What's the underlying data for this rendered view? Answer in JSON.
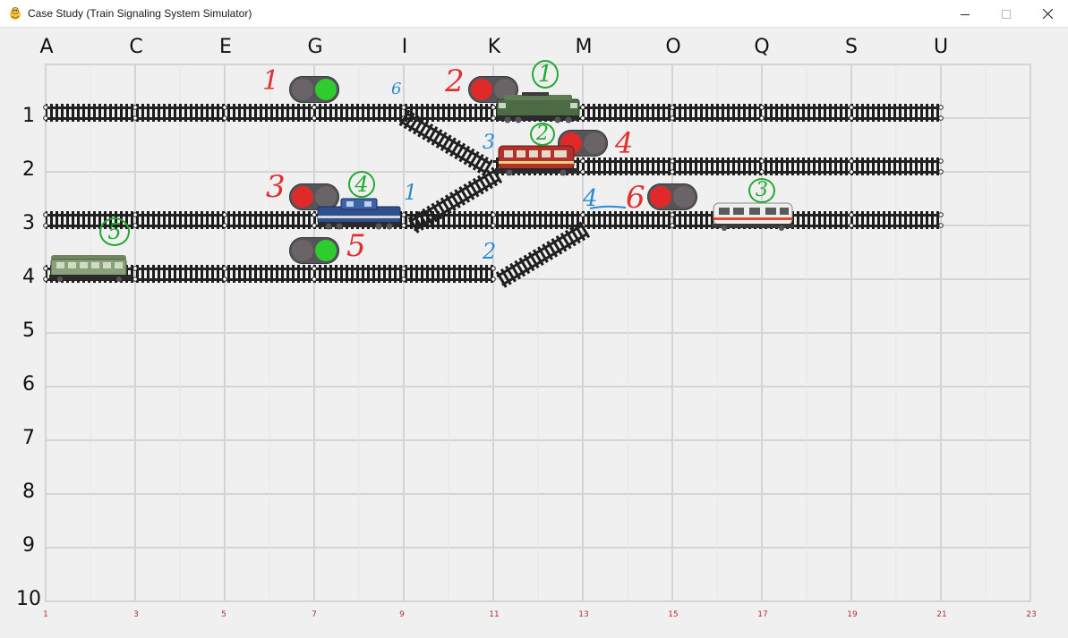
{
  "window": {
    "title": "Case Study (Train Signaling System Simulator)",
    "icon": "pygame-snake-icon",
    "controls": [
      "minimize-icon",
      "maximize-icon",
      "close-icon"
    ]
  },
  "grid": {
    "column_labels": [
      "A",
      "C",
      "E",
      "G",
      "I",
      "K",
      "M",
      "O",
      "Q",
      "S",
      "U"
    ],
    "row_labels": [
      "1",
      "2",
      "3",
      "4",
      "5",
      "6",
      "7",
      "8",
      "9",
      "10"
    ],
    "bottom_ticks": [
      "1",
      "3",
      "5",
      "7",
      "9",
      "11",
      "13",
      "15",
      "17",
      "19",
      "21",
      "23"
    ]
  },
  "signals": [
    {
      "id": "signal-1",
      "state": "green"
    },
    {
      "id": "signal-2",
      "state": "red"
    },
    {
      "id": "signal-3",
      "state": "red"
    },
    {
      "id": "signal-4",
      "state": "red"
    },
    {
      "id": "signal-5",
      "state": "green"
    },
    {
      "id": "signal-6",
      "state": "red"
    }
  ],
  "annotations": {
    "red": [
      "1",
      "2",
      "3",
      "4",
      "5",
      "6"
    ],
    "green": [
      "1",
      "2",
      "3",
      "4",
      "5"
    ],
    "blue": [
      "6",
      "3",
      "1",
      "2",
      "4"
    ]
  },
  "colors": {
    "signal_red": "#e02a2a",
    "signal_green": "#2ecc2e",
    "signal_off": "#6a6468",
    "annotation_red": "#e03030",
    "annotation_green": "#22aa33",
    "annotation_blue": "#2a8ad4",
    "grid_line": "#d2d2d2",
    "tick_red": "#b03030"
  },
  "trains": [
    {
      "id": "train-green-locomotive",
      "color": "#4a6b44"
    },
    {
      "id": "train-red-railcar",
      "color": "#b0302c"
    },
    {
      "id": "train-blue-locomotive",
      "color": "#2f4f8f"
    },
    {
      "id": "train-white-railcar",
      "color": "#e8e8e8"
    },
    {
      "id": "train-green-coach",
      "color": "#8aa07a"
    }
  ]
}
